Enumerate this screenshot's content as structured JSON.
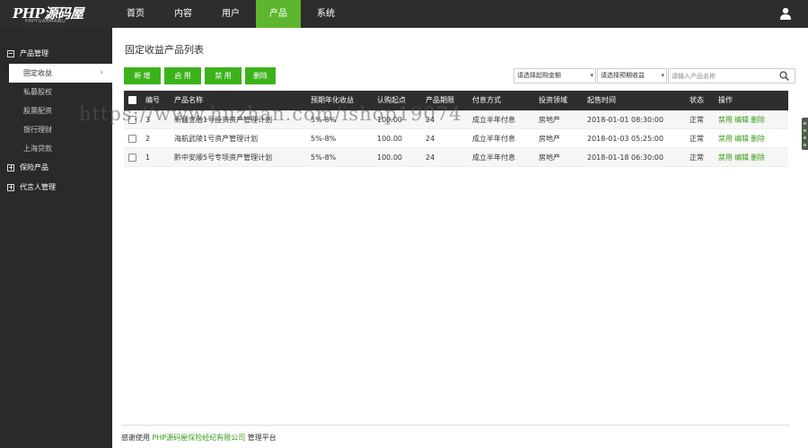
{
  "brand": {
    "logo_main": "PHP源码屋",
    "logo_sub": "PHPYUANMAWU"
  },
  "nav": {
    "items": [
      "首页",
      "内容",
      "用户",
      "产品",
      "系统"
    ],
    "active_index": 3
  },
  "sidebar": {
    "groups": [
      {
        "label": "产品管理",
        "expanded": true,
        "items": [
          "固定收益",
          "私募股权",
          "股票配资",
          "银行理财",
          "上海贷款"
        ],
        "active_item": 0
      },
      {
        "label": "保险产品",
        "expanded": false
      },
      {
        "label": "代言人管理",
        "expanded": false
      }
    ]
  },
  "page": {
    "title": "固定收益产品列表"
  },
  "toolbar": {
    "add": "新 增",
    "enable": "启 用",
    "disable": "禁 用",
    "delete": "删除"
  },
  "filters": {
    "amount": "请选择起购金额",
    "yield": "请选择预期收益",
    "search_placeholder": "请输入产品名称"
  },
  "table": {
    "headers": [
      "编号",
      "产品名称",
      "预期年化收益",
      "认购起点",
      "产品期限",
      "付息方式",
      "投资领域",
      "起售时间",
      "状态",
      "操作"
    ],
    "rows": [
      {
        "id": "3",
        "name": "新疆金融1号投资资产管理计划",
        "yield": "5%-8%",
        "min": "100.00",
        "term": "24",
        "pay": "成立半年付息",
        "field": "房地产",
        "time": "2018-01-01 08:30:00",
        "status": "正常"
      },
      {
        "id": "2",
        "name": "海航武陵1号资产管理计划",
        "yield": "5%-8%",
        "min": "100.00",
        "term": "24",
        "pay": "成立半年付息",
        "field": "房地产",
        "time": "2018-01-03 05:25:00",
        "status": "正常"
      },
      {
        "id": "1",
        "name": "黔中安顺5号专项资产管理计划",
        "yield": "5%-8%",
        "min": "100.00",
        "term": "24",
        "pay": "成立半年付息",
        "field": "房地产",
        "time": "2018-01-18 06:30:00",
        "status": "正常"
      }
    ],
    "ops": [
      "禁用",
      "编辑",
      "删除"
    ]
  },
  "footer": {
    "prefix": "感谢使用 ",
    "company": "PHP源码屋保险经纪有限公司",
    "suffix": " 管理平台"
  },
  "watermark": "https://www.huzhan.com/ishop19074",
  "colors": {
    "accent": "#5cb72e",
    "button": "#3cb21a",
    "link": "#3a9d1c",
    "topbar": "#2d2d2d",
    "sidebar": "#2a2a2a"
  }
}
